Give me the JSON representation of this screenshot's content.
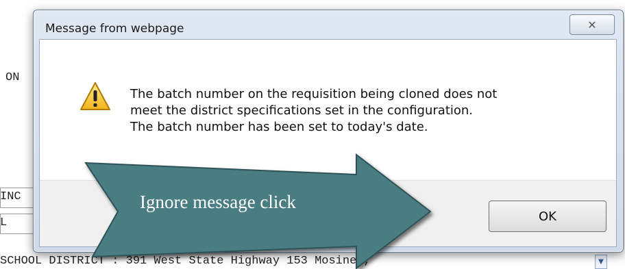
{
  "background": {
    "fragment_1": "ON",
    "fragment_2": "INC",
    "fragment_3": "L",
    "bottom_line": "SCHOOL DISTRICT   :   391 West State Highway 153   Mosinee,",
    "scroll_arrow": "▼"
  },
  "dialog": {
    "title": "Message from webpage",
    "close_glyph": "✕",
    "icon": "warning-icon",
    "message_lines": [
      "The batch number on the requisition being cloned does not",
      "meet the district specifications set in the configuration.",
      "The batch number has been set to today's date."
    ],
    "ok_label": "OK"
  },
  "callout": {
    "text": "Ignore message click",
    "color": "#4a7d82"
  }
}
